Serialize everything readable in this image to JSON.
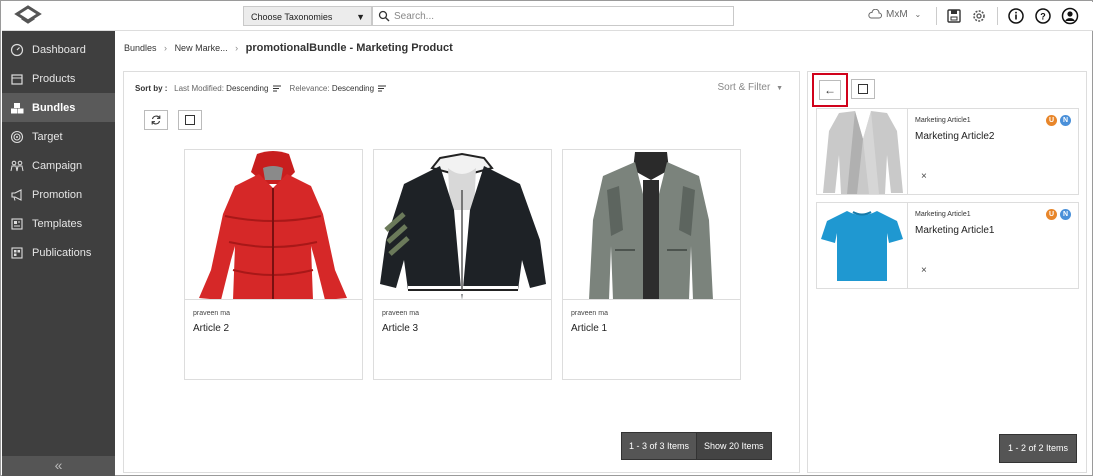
{
  "topbar": {
    "taxonomy_label": "Choose Taxonomies",
    "search_placeholder": "Search...",
    "user_menu": "MxM"
  },
  "sidebar": {
    "items": [
      {
        "label": "Dashboard",
        "icon": "dashboard-icon"
      },
      {
        "label": "Products",
        "icon": "products-icon"
      },
      {
        "label": "Bundles",
        "icon": "bundles-icon",
        "active": true
      },
      {
        "label": "Target",
        "icon": "target-icon"
      },
      {
        "label": "Campaign",
        "icon": "campaign-icon"
      },
      {
        "label": "Promotion",
        "icon": "megaphone-icon"
      },
      {
        "label": "Templates",
        "icon": "templates-icon"
      },
      {
        "label": "Publications",
        "icon": "publications-icon"
      }
    ],
    "collapse_label": "«"
  },
  "breadcrumb": {
    "items": [
      "Bundles",
      "New Marke..."
    ],
    "current": "promotionalBundle - Marketing Product"
  },
  "main": {
    "sort_by_label": "Sort by :",
    "sort1_label": "Last Modified:",
    "sort1_value": "Descending",
    "sort2_label": "Relevance:",
    "sort2_value": "Descending",
    "sort_filter_label": "Sort & Filter",
    "cards": [
      {
        "owner": "praveen ma",
        "title": "Article 2",
        "image": "red-jacket"
      },
      {
        "owner": "praveen ma",
        "title": "Article 3",
        "image": "black-jacket"
      },
      {
        "owner": "praveen ma",
        "title": "Article 1",
        "image": "grey-jacket"
      }
    ],
    "pager_count": "1 - 3 of 3 Items",
    "pager_show": "Show 20 Items"
  },
  "right_panel": {
    "items": [
      {
        "subtitle": "Marketing Article1",
        "title": "Marketing Article2",
        "image": "grey-coat",
        "badges": [
          "U",
          "N"
        ],
        "remove": "×"
      },
      {
        "subtitle": "Marketing Article1",
        "title": "Marketing Article1",
        "image": "blue-tshirt",
        "badges": [
          "U",
          "N"
        ],
        "remove": "×"
      }
    ],
    "back_icon": "←",
    "pager_count": "1 - 2 of 2 Items"
  },
  "colors": {
    "sidebar_bg": "#3f3f3f",
    "highlight_border": "#d0021b",
    "badge_u": "#e8862a",
    "badge_n": "#4a90d9"
  }
}
